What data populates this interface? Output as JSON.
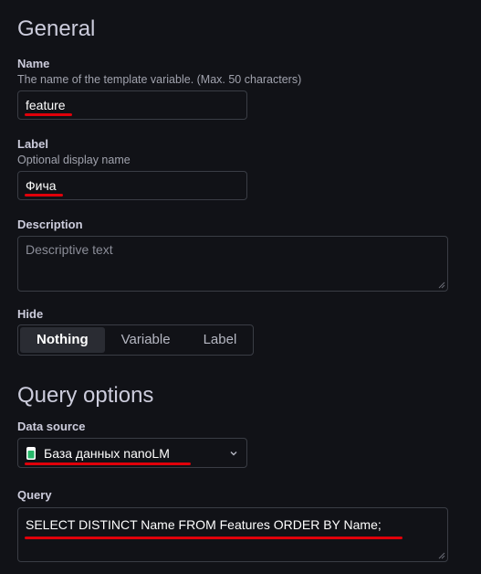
{
  "general": {
    "title": "General",
    "name": {
      "label": "Name",
      "description": "The name of the template variable. (Max. 50 characters)",
      "value": "feature"
    },
    "label_field": {
      "label": "Label",
      "description": "Optional display name",
      "value": "Фича"
    },
    "description_field": {
      "label": "Description",
      "placeholder": "Descriptive text"
    },
    "hide": {
      "label": "Hide",
      "options": [
        "Nothing",
        "Variable",
        "Label"
      ],
      "selected": "Nothing"
    }
  },
  "query_options": {
    "title": "Query options",
    "data_source": {
      "label": "Data source",
      "value": "База данных nanoLM",
      "icon": "database-icon"
    },
    "query": {
      "label": "Query",
      "value": "SELECT DISTINCT Name FROM Features ORDER BY Name;"
    }
  },
  "colors": {
    "annotation_underline": "#e0000a",
    "background": "#111217",
    "db_icon": "#27b86a"
  }
}
